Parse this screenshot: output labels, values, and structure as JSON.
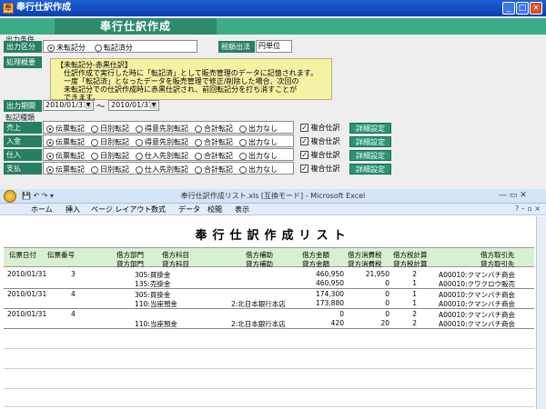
{
  "window": {
    "title": "奉行仕訳作成",
    "min": "_",
    "max": "□",
    "close": "×"
  },
  "form": {
    "title": "奉行仕訳作成",
    "output_section": "出力条件",
    "output_kbn_label": "出力区分",
    "output_kbn_options": [
      "未転記分",
      "転記済分"
    ],
    "tax_method_label": "税額出法",
    "tax_method_value": "円単位",
    "summary_label": "処理概要",
    "memo_lines": [
      "【未転記分-赤黒仕訳】",
      "　仕訳作成で実行した時に「転記済」として販売管理のデータに記憶されます。",
      "　一度「転記済」となったデータを販売管理で修正/削除した場合、次回の",
      "　未転記分での仕訳作成時に赤黒仕訳され、前回転記分を打ち消すことが",
      "　できます。"
    ],
    "period_label": "出力期間",
    "period_from": "2010/01/31",
    "period_sep": "～",
    "period_to": "2010/01/31",
    "transfer_section": "転記種類",
    "rows": [
      {
        "label": "売上",
        "options": [
          "伝票転記",
          "日別転記",
          "得意先別転記",
          "合計転記",
          "出力なし"
        ],
        "sel": 0,
        "chk": "複合仕訳",
        "btn": "詳細設定"
      },
      {
        "label": "入金",
        "options": [
          "伝票転記",
          "日別転記",
          "得意先別転記",
          "合計転記",
          "出力なし"
        ],
        "sel": 0,
        "chk": "複合仕訳",
        "btn": "詳細設定"
      },
      {
        "label": "仕入",
        "options": [
          "伝票転記",
          "日別転記",
          "仕入先別転記",
          "合計転記",
          "出力なし"
        ],
        "sel": 0,
        "chk": "複合仕訳",
        "btn": "詳細設定"
      },
      {
        "label": "支払",
        "options": [
          "伝票転記",
          "日別転記",
          "仕入先別転記",
          "合計転記",
          "出力なし"
        ],
        "sel": 0,
        "chk": "複合仕訳",
        "btn": "詳細設定"
      }
    ]
  },
  "excel": {
    "title": "奉行仕訳作成リスト.xls [互換モード] - Microsoft Excel",
    "tabs": [
      "ホーム",
      "挿入",
      "ページ レイアウト",
      "数式",
      "データ",
      "校閲",
      "表示"
    ],
    "report_title": "奉行仕訳作成リスト",
    "headers": {
      "r1": [
        "伝票日付",
        "伝票番号",
        "借方部門",
        "借方科目",
        "借方補助",
        "借方金額",
        "借方消費税",
        "借方税計算",
        "借方取引先"
      ],
      "r2": [
        "",
        "",
        "貸方部門",
        "貸方科目",
        "貸方補助",
        "貸方金額",
        "貸方消費税",
        "貸方税計算",
        "貸方取引先"
      ]
    },
    "records": [
      {
        "date": "2010/01/31",
        "no": "3",
        "l1": [
          "305:買掛金",
          "",
          "460,950",
          "21,950",
          "2",
          "A00010:クマンバチ商会"
        ],
        "l2": [
          "135:売掛金",
          "",
          "460,950",
          "0",
          "1",
          "A00010:クワクロウ販売"
        ]
      },
      {
        "date": "2010/01/31",
        "no": "4",
        "l1": [
          "305:買掛金",
          "",
          "174,300",
          "0",
          "1",
          "A00010:クマンバチ商会"
        ],
        "l2": [
          "110:当座預金",
          "2:北日本銀行本店",
          "173,880",
          "0",
          "1",
          "A00010:クマンバチ商会"
        ]
      },
      {
        "date": "2010/01/31",
        "no": "4",
        "l1": [
          "",
          "",
          "0",
          "0",
          "2",
          "A00010:クマンバチ商会"
        ],
        "l2": [
          "110:当座預金",
          "2:北日本銀行本店",
          "420",
          "20",
          "2",
          "A00010:クマンバチ商会"
        ]
      }
    ]
  }
}
